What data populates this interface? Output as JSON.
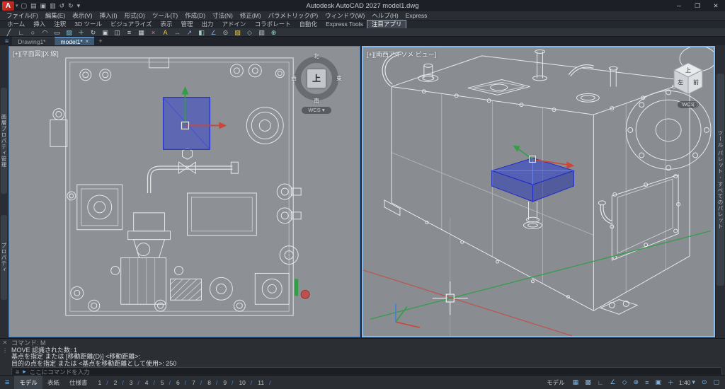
{
  "titlebar": {
    "logo": "A",
    "logo_caret": "▾",
    "title": "Autodesk AutoCAD 2027   model1.dwg",
    "quick_access": [
      {
        "name": "new-file-icon",
        "glyph": "▢"
      },
      {
        "name": "open-file-icon",
        "glyph": "▤"
      },
      {
        "name": "save-icon",
        "glyph": "▣"
      },
      {
        "name": "print-icon",
        "glyph": "▥"
      },
      {
        "name": "undo-icon",
        "glyph": "↺"
      },
      {
        "name": "redo-icon",
        "glyph": "↻"
      },
      {
        "name": "qat-dropdown-icon",
        "glyph": "▾"
      }
    ],
    "minimize": "─",
    "maximize": "❐",
    "close": "✕"
  },
  "menubar": {
    "items": [
      "ファイル(F)",
      "編集(E)",
      "表示(V)",
      "挿入(I)",
      "形式(O)",
      "ツール(T)",
      "作成(D)",
      "寸法(N)",
      "修正(M)",
      "パラメトリック(P)",
      "ウィンドウ(W)",
      "ヘルプ(H)",
      "Express"
    ]
  },
  "ribbon": {
    "tabs": [
      {
        "label": "ホーム"
      },
      {
        "label": "挿入"
      },
      {
        "label": "注釈"
      },
      {
        "label": "3D ツール"
      },
      {
        "label": "ビジュアライズ"
      },
      {
        "label": "表示"
      },
      {
        "label": "管理"
      },
      {
        "label": "出力"
      },
      {
        "label": "アドイン"
      },
      {
        "label": "コラボレート"
      },
      {
        "label": "自動化"
      },
      {
        "label": "Express Tools"
      },
      {
        "label": "注目アプリ",
        "active": true
      }
    ],
    "tools": [
      {
        "name": "line-tool-icon",
        "glyph": "╱",
        "color": "#ccd1d6"
      },
      {
        "name": "polyline-tool-icon",
        "glyph": "∟",
        "color": "#ccd1d6"
      },
      {
        "name": "circle-tool-icon",
        "glyph": "○",
        "color": "#ccd1d6"
      },
      {
        "name": "arc-tool-icon",
        "glyph": "◠",
        "color": "#ccd1d6"
      },
      {
        "name": "rectangle-tool-icon",
        "glyph": "▭",
        "color": "#ccd1d6"
      },
      {
        "name": "hatch-tool-icon",
        "glyph": "▨",
        "color": "#7fc4de"
      },
      {
        "name": "move-tool-icon",
        "glyph": "＋",
        "color": "#9fd8c6"
      },
      {
        "name": "rotate-tool-icon",
        "glyph": "↻",
        "color": "#9fd8c6"
      },
      {
        "name": "copy-tool-icon",
        "glyph": "▣",
        "color": "#ccd1d6"
      },
      {
        "name": "mirror-tool-icon",
        "glyph": "◫",
        "color": "#ccd1d6"
      },
      {
        "name": "offset-tool-icon",
        "glyph": "≡",
        "color": "#ccd1d6"
      },
      {
        "name": "array-tool-icon",
        "glyph": "▦",
        "color": "#ccd1d6"
      },
      {
        "name": "erase-tool-icon",
        "glyph": "×",
        "color": "#d98c8c"
      },
      {
        "name": "text-tool-icon",
        "glyph": "A",
        "color": "#e4c85a"
      },
      {
        "name": "dimension-tool-icon",
        "glyph": "↔",
        "color": "#7fa8d9"
      },
      {
        "name": "leader-tool-icon",
        "glyph": "↗",
        "color": "#7fa8d9"
      },
      {
        "name": "block-tool-icon",
        "glyph": "◧",
        "color": "#9fd8c6"
      },
      {
        "name": "angle-tool-icon",
        "glyph": "∠",
        "color": "#7fa8d9"
      },
      {
        "name": "point-tool-icon",
        "glyph": "⊙",
        "color": "#ccd1d6"
      },
      {
        "name": "gradient-tool-icon",
        "glyph": "▧",
        "color": "#e4c85a"
      },
      {
        "name": "isodraft-tool-icon",
        "glyph": "◇",
        "color": "#7fc4de"
      },
      {
        "name": "table-tool-icon",
        "glyph": "▥",
        "color": "#ccd1d6"
      },
      {
        "name": "osnap-tool-icon",
        "glyph": "⊕",
        "color": "#9fd8c6"
      }
    ]
  },
  "filetabs": {
    "menu_icon": "≡",
    "tabs": [
      {
        "label": "Drawing1*"
      },
      {
        "label": "model1*",
        "close": "×",
        "active": true
      }
    ],
    "new_tab": "+"
  },
  "side_panels": {
    "left_top": "画層プロパティ管理",
    "left_bottom": "プロパティ",
    "right": "ツール パレット - すべてのパレット"
  },
  "viewports": {
    "left": {
      "label": "[+][平面図][X 線]",
      "viewcube": {
        "north": "北",
        "west": "西",
        "top": "上",
        "east": "東",
        "south": "南",
        "wcs": "WCS ▾"
      }
    },
    "right": {
      "label": "[+][南西アイソメ ビュー]",
      "cube": {
        "top": "上",
        "left": "左",
        "front": "前"
      },
      "wcs": "WCS"
    }
  },
  "command": {
    "close_icon": "✕",
    "grip_icon": "⋮",
    "lines": [
      {
        "text": "コマンド: M",
        "dim": true
      },
      {
        "text": "MOVE 認識された数: 1"
      },
      {
        "text": "基点を指定 または [移動距離(D)] <移動距離>:"
      },
      {
        "text": "目的の点を指定 または <基点を移動距離として使用>: 250"
      }
    ],
    "customize_icon": "≡",
    "prompt_icon": "▸",
    "placeholder": "ここにコマンドを入力"
  },
  "statusbar": {
    "menu_icon": "≡",
    "layout_tabs": [
      {
        "label": "モデル",
        "active": true
      },
      {
        "label": "表紙"
      },
      {
        "label": "仕様書"
      }
    ],
    "pages": [
      "1",
      "2",
      "3",
      "4",
      "5",
      "6",
      "7",
      "8",
      "9",
      "10",
      "11"
    ],
    "right": [
      {
        "name": "model-space-toggle",
        "label": "モデル"
      },
      {
        "name": "grid-icon",
        "glyph": "▦"
      },
      {
        "name": "snap-icon",
        "glyph": "▩"
      },
      {
        "name": "ortho-icon",
        "glyph": "∟"
      },
      {
        "name": "polar-tracking-icon",
        "glyph": "∠"
      },
      {
        "name": "isodraft-icon",
        "glyph": "◇"
      },
      {
        "name": "osnap-icon",
        "glyph": "⊕"
      },
      {
        "name": "lineweight-icon",
        "glyph": "≡"
      },
      {
        "name": "selection-cycling-icon",
        "glyph": "▣"
      },
      {
        "name": "dynamic-input-icon",
        "glyph": "＋"
      },
      {
        "name": "annotation-scale",
        "label": "1:40",
        "glyph": "▾"
      },
      {
        "name": "workspace-icon",
        "glyph": "⊙"
      },
      {
        "name": "clean-screen-icon",
        "glyph": "▢"
      }
    ]
  }
}
